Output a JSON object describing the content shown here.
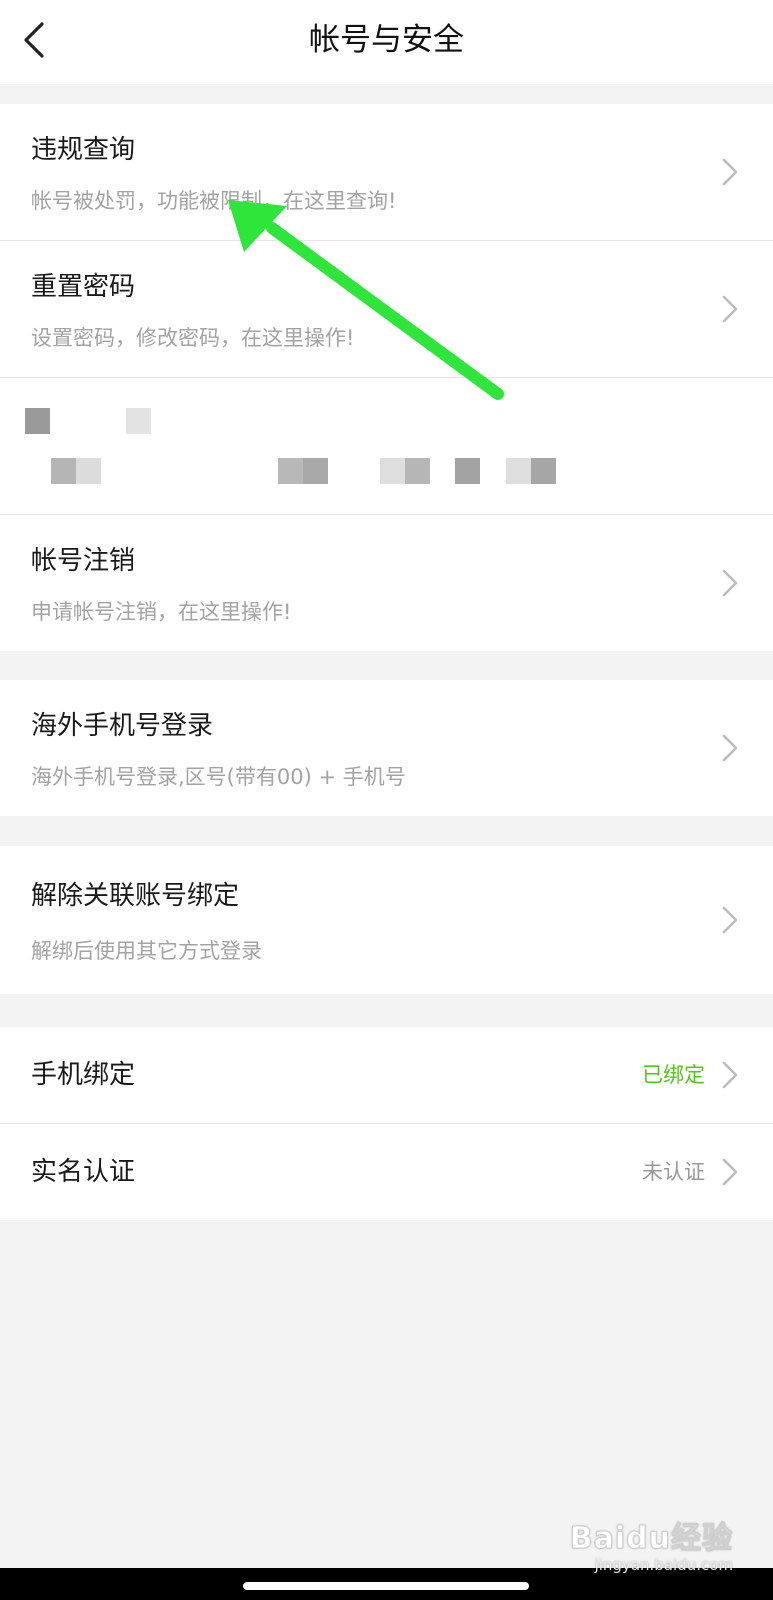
{
  "header": {
    "title": "帐号与安全",
    "back_icon": "chevron-left-icon"
  },
  "group_account": {
    "items": [
      {
        "title": "违规查询",
        "subtitle": "帐号被处罚，功能被限制，在这里查询!"
      },
      {
        "title": "重置密码",
        "subtitle": "设置密码，修改密码，在这里操作!"
      },
      {
        "redacted": true
      },
      {
        "title": "帐号注销",
        "subtitle": "申请帐号注销，在这里操作!"
      }
    ]
  },
  "group_overseas": {
    "title": "海外手机号登录",
    "subtitle": "海外手机号登录,区号(带有00) + 手机号"
  },
  "group_unbind": {
    "title": "解除关联账号绑定",
    "subtitle": "解绑后使用其它方式登录"
  },
  "group_binding": {
    "items": [
      {
        "title": "手机绑定",
        "value": "已绑定",
        "value_color": "#52c41a"
      },
      {
        "title": "实名认证",
        "value": "未认证",
        "value_color": "#999999"
      }
    ]
  },
  "colors": {
    "annotation_arrow": "#2ee53a",
    "background": "#f3f3f3",
    "chevron": "#bdbdbd"
  },
  "watermark": {
    "logo": "Baidu经验",
    "url": "jingyan.baidu.com"
  }
}
